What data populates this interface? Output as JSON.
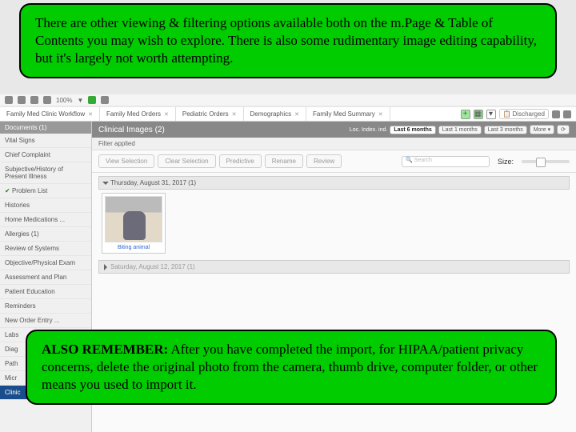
{
  "callouts": {
    "top": "There are other viewing & filtering options available both on the m.Page & Table of Contents you may wish to explore.  There is also some rudimentary image editing capability, but it's largely not worth attempting.",
    "bottom_strong": "ALSO REMEMBER:",
    "bottom": "  After you have completed the import, for HIPAA/patient privacy concerns, delete the original photo from the camera, thumb drive, computer folder, or other means you used to import it."
  },
  "toolbar": {
    "zoom": "100%"
  },
  "tabs": [
    "Family Med Clinic Workflow",
    "Family Med Orders",
    "Pediatric Orders",
    "Demographics",
    "Family Med Summary"
  ],
  "status_pill": "Discharged",
  "sidebar": {
    "header": "Documents (1)",
    "items": [
      "Vital Signs",
      "Chief Complaint",
      "Subjective/History of Present Illness",
      "Problem List",
      "Histories",
      "Home Medications  ...",
      "Allergies (1)",
      "Review of Systems",
      "Objective/Physical Exam",
      "Assessment and Plan",
      "Patient Education",
      "Reminders",
      "New Order Entry  ...",
      "Labs",
      "Diag",
      "Path",
      "Micr",
      "Clinic"
    ]
  },
  "clinical": {
    "title": "Clinical Images (2)",
    "index_label": "Loc. Index. ind.",
    "filters": [
      "Last 6 months",
      "Last 1 months",
      "Last 3 months",
      "More"
    ],
    "filter_applied": "Filter applied",
    "buttons": [
      "View Selection",
      "Clear Selection",
      "Predictive",
      "Rename",
      "Review"
    ],
    "search_ph": "Search",
    "size_label": "Size:",
    "date1": "Thursday, August 31, 2017 (1)",
    "thumb_caption": "Biting animal",
    "date2": "Saturday, August 12, 2017 (1)"
  }
}
